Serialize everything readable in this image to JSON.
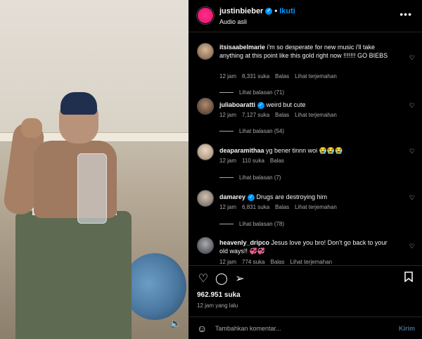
{
  "post": {
    "username": "justinbieber",
    "follow_label": "Ikuti",
    "audio_label": "Audio asli",
    "likes": "962.951 suka",
    "time_ago": "12 jam yang lalu"
  },
  "comments": [
    {
      "username": "itsisaabelmarie",
      "text": "i'm so desperate for new music i'll take anything at this point like this gold right now !!!!!!! GO BIEBS",
      "time": "12 jam",
      "likes": "8,331 suka",
      "reply_label": "Balas",
      "translate_label": "Lihat terjemahan",
      "replies_label": "Lihat balasan (71)",
      "avatar_color": "#c9a27f"
    },
    {
      "username": "juliaboaratti",
      "text": "weird but cute",
      "time": "12 jam",
      "likes": "7,127 suka",
      "reply_label": "Balas",
      "translate_label": "Lihat terjemahan",
      "replies_label": "Lihat balasan (54)",
      "avatar_color": "#8a6a55"
    },
    {
      "username": "deaparamithaa",
      "text": "yg bener tinnn woi 😭😭😭",
      "time": "12 jam",
      "likes": "110 suka",
      "reply_label": "Balas",
      "replies_label": "Lihat balasan (7)",
      "avatar_color": "#d8c3b0"
    },
    {
      "username": "damarey",
      "text": "Drugs are destroying him",
      "time": "12 jam",
      "likes": "6,831 suka",
      "reply_label": "Balas",
      "translate_label": "Lihat terjemahan",
      "replies_label": "Lihat balasan (78)",
      "avatar_color": "#b0a294"
    },
    {
      "username": "heavenly_dripco",
      "text": "Jesus love you bro! Don't go back to your old ways!! 💞💞",
      "time": "12 jam",
      "likes": "774 suka",
      "reply_label": "Balas",
      "translate_label": "Lihat terjemahan",
      "avatar_color": "#7d7f85"
    }
  ],
  "composer": {
    "placeholder": "Tambahkan komentar...",
    "send_label": "Kirim"
  },
  "colors": {
    "accent": "#0095f6",
    "brand_avatar": "#ff2d8a"
  }
}
